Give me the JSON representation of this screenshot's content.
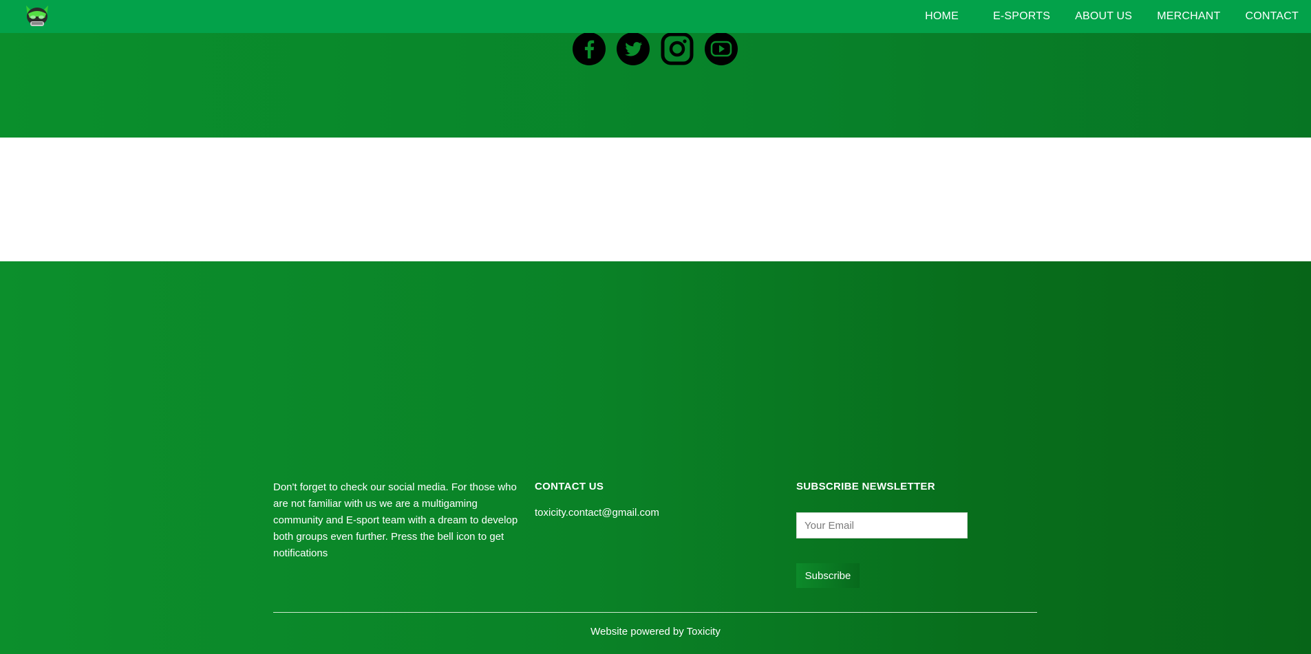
{
  "nav": {
    "logo": "team-logo",
    "links": [
      "HOME",
      "E-SPORTS",
      "ABOUT US",
      "MERCHANT",
      "CONTACT"
    ]
  },
  "social": [
    "facebook-icon",
    "twitter-icon",
    "instagram-icon",
    "youtube-icon"
  ],
  "footer": {
    "about_text": "Don't forget to check our social media. For those who are not familiar with us we are a multigaming community and E-sport team with a dream to develop both groups even further. Press the bell icon to get notifications",
    "contact_heading": "CONTACT US",
    "contact_email": "toxicity.contact@gmail.com",
    "newsletter_heading": "SUBSCRIBE NEWSLETTER",
    "email_placeholder": "Your Email",
    "subscribe_label": "Subscribe",
    "powered_by": "Website powered by Toxicity"
  },
  "colors": {
    "nav_bg": "#03a24a",
    "footer_green": "#0a8227",
    "footer_dark": "#076518"
  }
}
